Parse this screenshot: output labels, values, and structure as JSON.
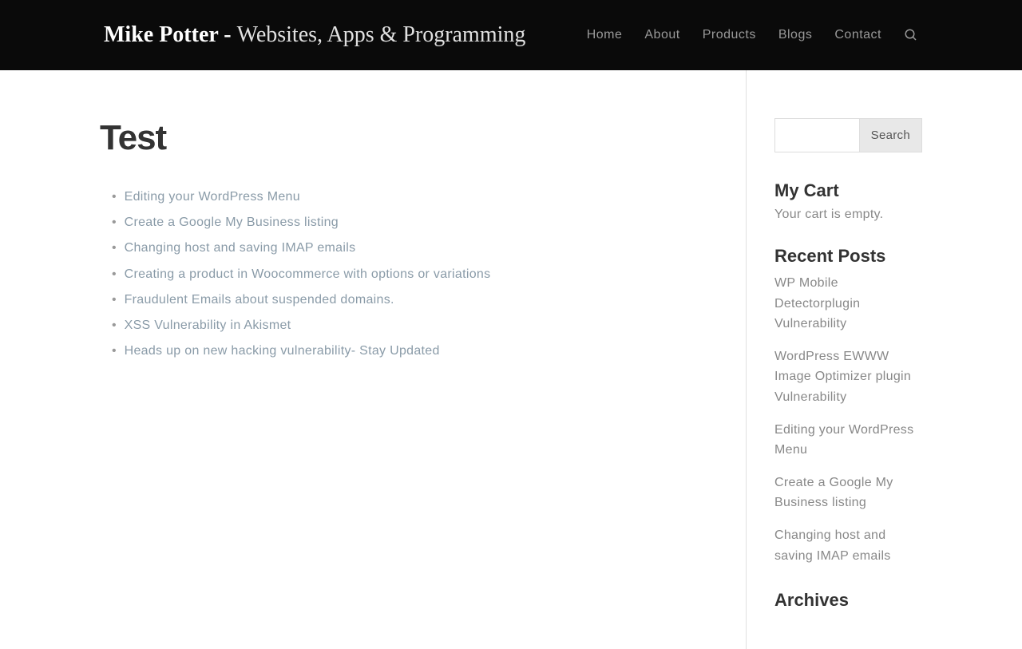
{
  "header": {
    "logo_bold": "Mike Potter - ",
    "logo_light": "Websites, Apps & Programming",
    "nav": [
      "Home",
      "About",
      "Products",
      "Blogs",
      "Contact"
    ]
  },
  "main": {
    "title": "Test",
    "posts": [
      "Editing your WordPress Menu",
      "Create a Google My Business listing",
      "Changing host and saving IMAP emails",
      "Creating a product in Woocommerce with options or variations",
      "Fraudulent Emails about suspended domains.",
      "XSS Vulnerability in Akismet",
      "Heads up on new hacking vulnerability- Stay Updated"
    ]
  },
  "sidebar": {
    "search_button": "Search",
    "my_cart_heading": "My Cart",
    "my_cart_text": "Your cart is empty.",
    "recent_posts_heading": "Recent Posts",
    "recent_posts": [
      "WP Mobile Detectorplugin Vulnerability",
      "WordPress EWWW Image Optimizer plugin Vulnerability",
      "Editing your WordPress Menu",
      "Create a Google My Business listing",
      "Changing host and saving IMAP emails"
    ],
    "archives_heading": "Archives"
  }
}
